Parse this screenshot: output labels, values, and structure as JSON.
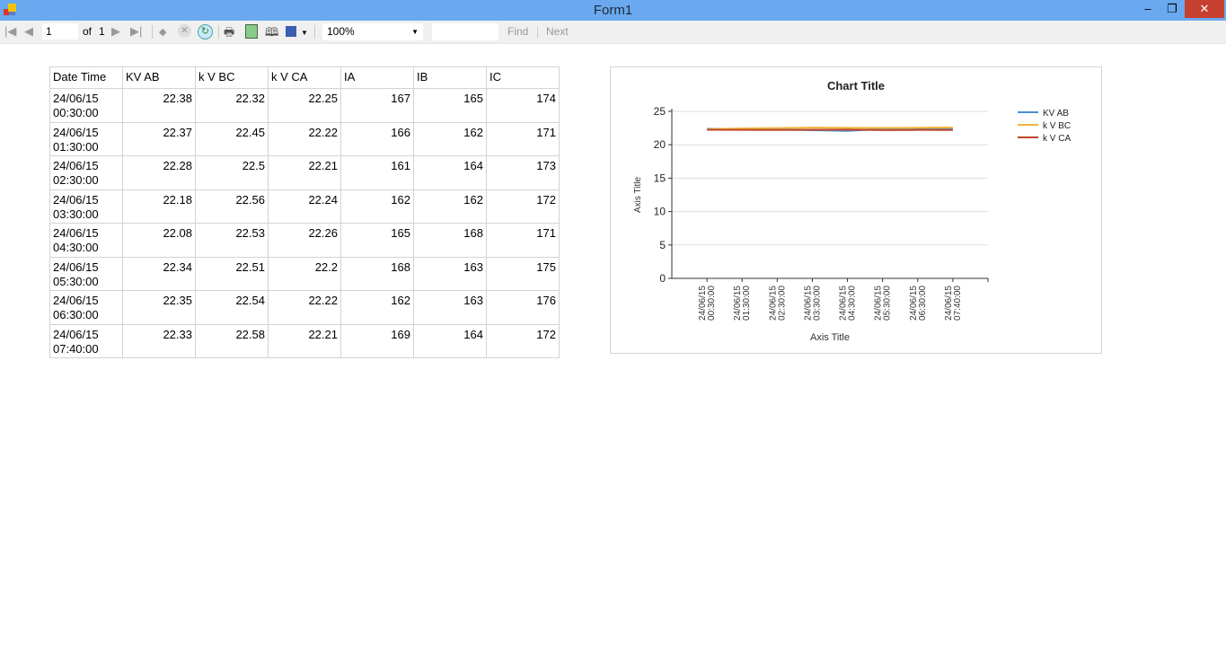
{
  "window": {
    "title": "Form1",
    "minimize": "–",
    "restore": "❐",
    "close": "✕"
  },
  "toolbar": {
    "page": "1",
    "of_label": "of",
    "total_pages": "1",
    "zoom": "100%",
    "find": "Find",
    "next": "Next"
  },
  "table": {
    "headers": [
      "Date Time",
      "KV AB",
      "k V BC",
      "k V CA",
      "IA",
      "IB",
      "IC"
    ],
    "rows": [
      [
        "24/06/15 00:30:00",
        "22.38",
        "22.32",
        "22.25",
        "167",
        "165",
        "174"
      ],
      [
        "24/06/15 01:30:00",
        "22.37",
        "22.45",
        "22.22",
        "166",
        "162",
        "171"
      ],
      [
        "24/06/15 02:30:00",
        "22.28",
        "22.5",
        "22.21",
        "161",
        "164",
        "173"
      ],
      [
        "24/06/15 03:30:00",
        "22.18",
        "22.56",
        "22.24",
        "162",
        "162",
        "172"
      ],
      [
        "24/06/15 04:30:00",
        "22.08",
        "22.53",
        "22.26",
        "165",
        "168",
        "171"
      ],
      [
        "24/06/15 05:30:00",
        "22.34",
        "22.51",
        "22.2",
        "168",
        "163",
        "175"
      ],
      [
        "24/06/15 06:30:00",
        "22.35",
        "22.54",
        "22.22",
        "162",
        "163",
        "176"
      ],
      [
        "24/06/15 07:40:00",
        "22.33",
        "22.58",
        "22.21",
        "169",
        "164",
        "172"
      ]
    ]
  },
  "chart_data": {
    "type": "line",
    "title": "Chart Title",
    "xlabel": "Axis Title",
    "ylabel": "Axis Title",
    "ylim": [
      0,
      25
    ],
    "yticks": [
      0,
      5,
      10,
      15,
      20,
      25
    ],
    "grid": true,
    "legend": "top-right",
    "categories": [
      [
        "24/06/15",
        "00:30:00"
      ],
      [
        "24/06/15",
        "01:30:00"
      ],
      [
        "24/06/15",
        "02:30:00"
      ],
      [
        "24/06/15",
        "03:30:00"
      ],
      [
        "24/06/15",
        "04:30:00"
      ],
      [
        "24/06/15",
        "05:30:00"
      ],
      [
        "24/06/15",
        "06:30:00"
      ],
      [
        "24/06/15",
        "07:40:00"
      ]
    ],
    "series": [
      {
        "name": "KV AB",
        "color": "#4a8fd6",
        "values": [
          22.38,
          22.37,
          22.28,
          22.18,
          22.08,
          22.34,
          22.35,
          22.33
        ]
      },
      {
        "name": "k V BC",
        "color": "#f0b43c",
        "values": [
          22.32,
          22.45,
          22.5,
          22.56,
          22.53,
          22.51,
          22.54,
          22.58
        ]
      },
      {
        "name": "k V CA",
        "color": "#c0462a",
        "values": [
          22.25,
          22.22,
          22.21,
          22.24,
          22.26,
          22.2,
          22.22,
          22.21
        ]
      }
    ]
  }
}
